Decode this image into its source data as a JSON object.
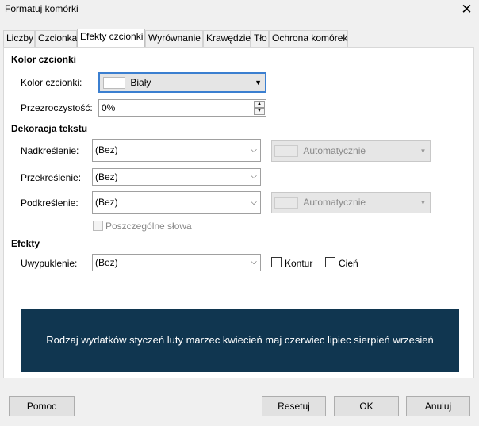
{
  "window": {
    "title": "Formatuj komórki",
    "close_glyph": "✕"
  },
  "tabs": [
    {
      "label": "Liczby"
    },
    {
      "label": "Czcionka"
    },
    {
      "label": "Efekty czcionki",
      "active": true
    },
    {
      "label": "Wyrównanie"
    },
    {
      "label": "Krawędzie"
    },
    {
      "label": "Tło"
    },
    {
      "label": "Ochrona komórek"
    }
  ],
  "font_color": {
    "section": "Kolor czcionki",
    "color_label": "Kolor czcionki:",
    "color_value": "Biały",
    "transparency_label": "Przezroczystość:",
    "transparency_value": "0%"
  },
  "decoration": {
    "section": "Dekoracja tekstu",
    "overline_label": "Nadkreślenie:",
    "overline_value": "(Bez)",
    "overline_color": "Automatycznie",
    "strikethrough_label": "Przekreślenie:",
    "strikethrough_value": "(Bez)",
    "underline_label": "Podkreślenie:",
    "underline_value": "(Bez)",
    "underline_color": "Automatycznie",
    "individual_words": "Poszczególne słowa"
  },
  "effects": {
    "section": "Efekty",
    "relief_label": "Uwypuklenie:",
    "relief_value": "(Bez)",
    "outline": "Kontur",
    "shadow": "Cień"
  },
  "preview": {
    "text": "Rodzaj wydatków styczeń luty marzec kwiecień maj czerwiec lipiec  sierpień wrzesień",
    "background": "#103650"
  },
  "buttons": {
    "help": "Pomoc",
    "reset": "Resetuj",
    "ok": "OK",
    "cancel": "Anuluj"
  }
}
